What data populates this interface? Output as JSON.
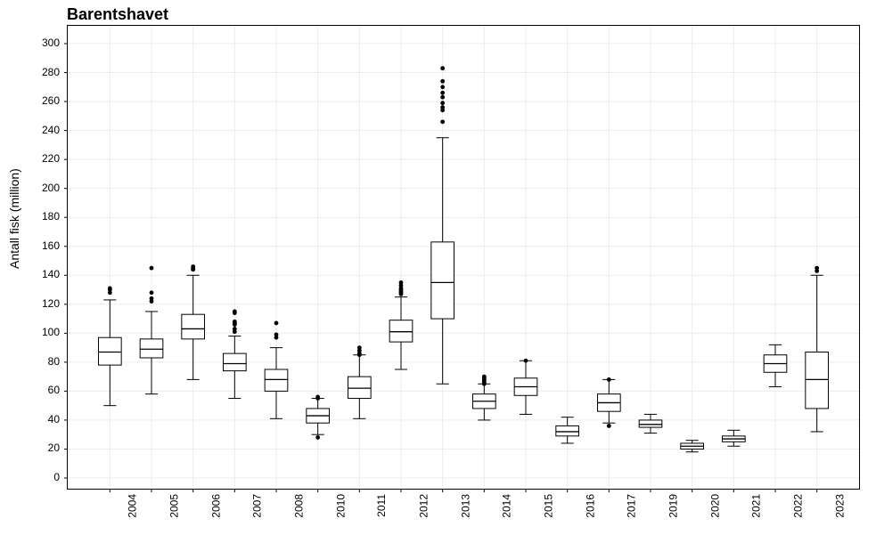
{
  "chart_data": {
    "type": "boxplot",
    "title": "Barentshavet",
    "xlabel": "",
    "ylabel": "Antall fisk (million)",
    "ylim": [
      0,
      300
    ],
    "yticks": [
      0,
      20,
      40,
      60,
      80,
      100,
      120,
      140,
      160,
      180,
      200,
      220,
      240,
      260,
      280,
      300
    ],
    "categories": [
      "2004",
      "2005",
      "2006",
      "2007",
      "2008",
      "2010",
      "2011",
      "2012",
      "2013",
      "2014",
      "2015",
      "2016",
      "2017",
      "2019",
      "2020",
      "2021",
      "2022",
      "2023"
    ],
    "series": [
      {
        "category": "2004",
        "min": 50,
        "q1": 78,
        "median": 87,
        "q3": 97,
        "max": 123,
        "outliers": [
          128,
          130,
          131
        ]
      },
      {
        "category": "2005",
        "min": 58,
        "q1": 83,
        "median": 89,
        "q3": 96,
        "max": 115,
        "outliers": [
          122,
          124,
          128,
          145
        ]
      },
      {
        "category": "2006",
        "min": 68,
        "q1": 96,
        "median": 103,
        "q3": 113,
        "max": 140,
        "outliers": [
          144,
          145,
          146
        ]
      },
      {
        "category": "2007",
        "min": 55,
        "q1": 74,
        "median": 79,
        "q3": 86,
        "max": 98,
        "outliers": [
          101,
          103,
          106,
          107,
          108,
          114,
          115
        ]
      },
      {
        "category": "2008",
        "min": 41,
        "q1": 60,
        "median": 68,
        "q3": 75,
        "max": 90,
        "outliers": [
          97,
          99,
          107
        ]
      },
      {
        "category": "2010",
        "min": 30,
        "q1": 38,
        "median": 43,
        "q3": 48,
        "max": 55,
        "outliers": [
          28,
          55,
          56
        ]
      },
      {
        "category": "2011",
        "min": 41,
        "q1": 55,
        "median": 62,
        "q3": 70,
        "max": 85,
        "outliers": [
          85,
          86,
          88,
          90
        ]
      },
      {
        "category": "2012",
        "min": 75,
        "q1": 94,
        "median": 101,
        "q3": 109,
        "max": 125,
        "outliers": [
          127,
          128,
          129,
          130,
          131,
          133,
          135
        ]
      },
      {
        "category": "2013",
        "min": 65,
        "q1": 110,
        "median": 135,
        "q3": 163,
        "max": 235,
        "outliers": [
          246,
          254,
          256,
          259,
          263,
          266,
          270,
          274,
          283
        ]
      },
      {
        "category": "2014",
        "min": 40,
        "q1": 48,
        "median": 53,
        "q3": 58,
        "max": 65,
        "outliers": [
          65,
          66,
          67,
          68,
          69,
          70
        ]
      },
      {
        "category": "2015",
        "min": 44,
        "q1": 57,
        "median": 63,
        "q3": 69,
        "max": 81,
        "outliers": [
          81
        ]
      },
      {
        "category": "2016",
        "min": 24,
        "q1": 29,
        "median": 32,
        "q3": 36,
        "max": 42,
        "outliers": []
      },
      {
        "category": "2017",
        "min": 38,
        "q1": 46,
        "median": 52,
        "q3": 58,
        "max": 68,
        "outliers": [
          36,
          68
        ]
      },
      {
        "category": "2019",
        "min": 31,
        "q1": 35,
        "median": 37,
        "q3": 40,
        "max": 44,
        "outliers": []
      },
      {
        "category": "2020",
        "min": 18,
        "q1": 20,
        "median": 22,
        "q3": 24,
        "max": 26,
        "outliers": []
      },
      {
        "category": "2021",
        "min": 22,
        "q1": 25,
        "median": 27,
        "q3": 29,
        "max": 33,
        "outliers": []
      },
      {
        "category": "2022",
        "min": 63,
        "q1": 73,
        "median": 79,
        "q3": 85,
        "max": 92,
        "outliers": []
      },
      {
        "category": "2023",
        "min": 32,
        "q1": 48,
        "median": 68,
        "q3": 87,
        "max": 140,
        "outliers": [
          143,
          145
        ]
      }
    ]
  }
}
